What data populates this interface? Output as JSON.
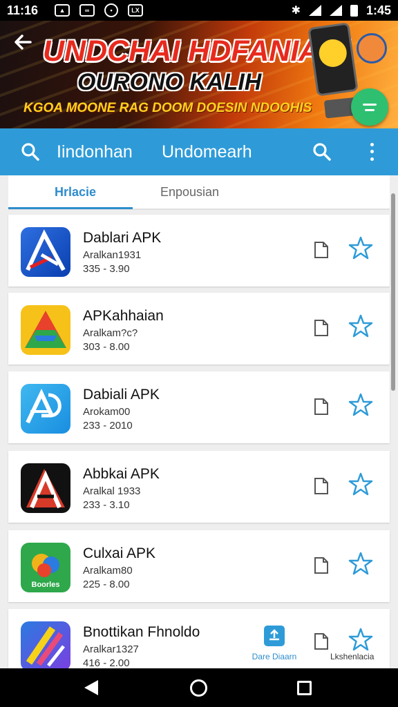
{
  "status_bar": {
    "time_left": "11:16",
    "icons": [
      "photo-icon",
      "messenger-icon",
      "chat-icon",
      "lx-icon"
    ],
    "time_right": "1:45"
  },
  "banner": {
    "line1": "UNDCHAI HDFANIAIN",
    "line2": "OURONO KALIH",
    "line3": "KGOA MOONE RAG DOOM DOESIN NDOOHIS"
  },
  "toolbar": {
    "title1": "Iindonhan",
    "title2": "Undomearh"
  },
  "tabs": [
    {
      "label": "Hrlacie",
      "active": true
    },
    {
      "label": "Enpousian",
      "active": false
    }
  ],
  "apps": [
    {
      "name": "Dablari APK",
      "subtitle": "Aralkan1931",
      "meta": "335 - 3.90"
    },
    {
      "name": "APKahhaian",
      "subtitle": "Aralkam?c?",
      "meta": "303 - 8.00"
    },
    {
      "name": "Dabiali APK",
      "subtitle": "Arokam00",
      "meta": "233 - 2010"
    },
    {
      "name": "Abbkai APK",
      "subtitle": "Aralkal 1933",
      "meta": "233 - 3.10"
    },
    {
      "name": "Culxai APK",
      "subtitle": "Aralkam80",
      "meta": "225 - 8.00",
      "icon_text": "Boorles"
    },
    {
      "name": "Bnottikan Fhnoldo",
      "subtitle": "Aralkar1327",
      "meta": "416 - 2.00"
    }
  ],
  "last_row_actions": {
    "download_label": "Dare Diaarn",
    "extra_label": "Lkshenlacia"
  },
  "colors": {
    "toolbar": "#2e9bd8",
    "accent": "#2e8ccc",
    "fab": "#2fbf71",
    "banner_title": "#e82a1e"
  }
}
